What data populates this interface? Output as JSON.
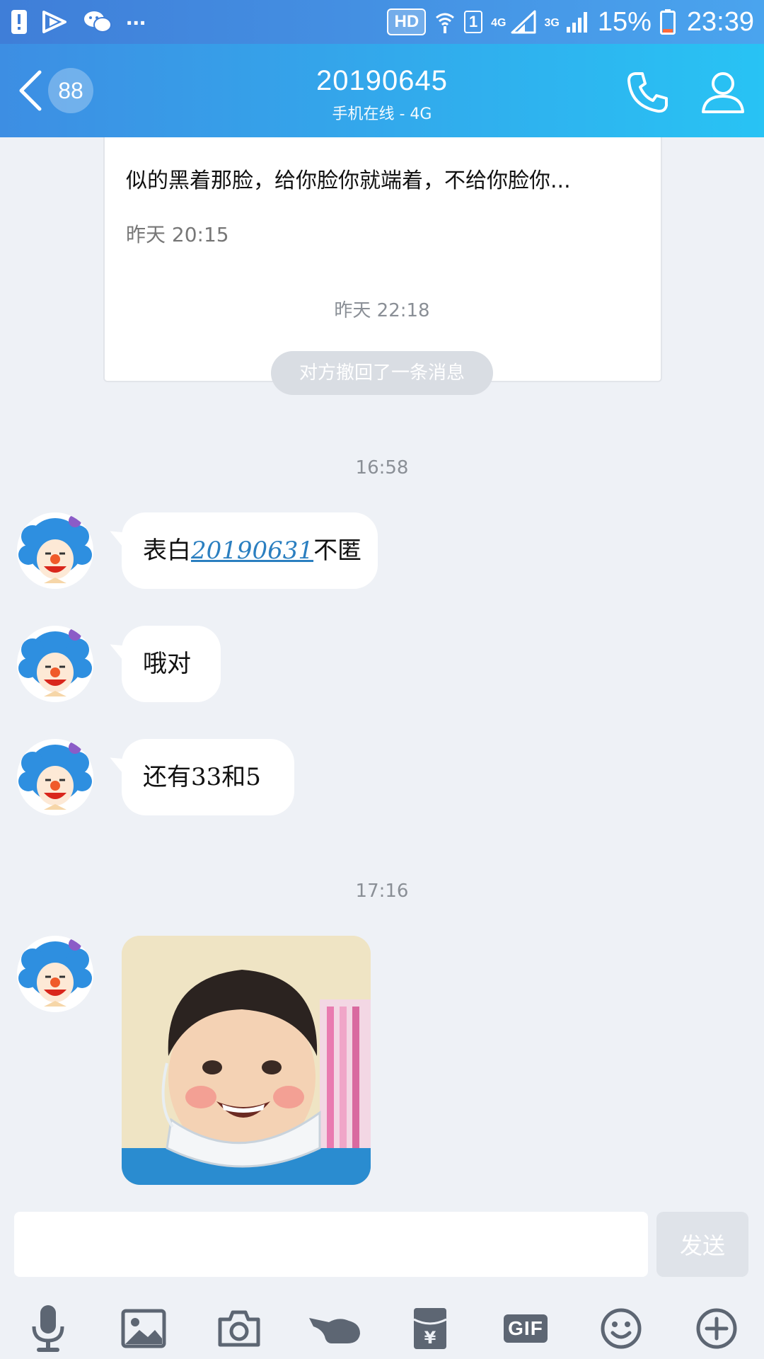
{
  "status_bar": {
    "hd": "HD",
    "sim": "1",
    "net1": "4G",
    "net2": "3G",
    "battery": "15%",
    "time": "23:39",
    "more": "..."
  },
  "header": {
    "unread_count": "88",
    "title": "20190645",
    "subtitle": "手机在线 - 4G"
  },
  "messages": {
    "card": {
      "body": "似的黑着那脸，给你脸你就端着，不给你脸你...",
      "time": "昨天 20:15"
    },
    "sep1": "昨天 22:18",
    "recall": "对方撤回了一条消息",
    "sep2": "16:58",
    "m1_prefix": "表白",
    "m1_link": "20190631",
    "m1_suffix": "不匿",
    "m2": "哦对",
    "m3": "还有33和5",
    "sep3": "17:16"
  },
  "input": {
    "placeholder": "",
    "send_label": "发送"
  },
  "toolbar": {
    "gif": "GIF"
  },
  "icons": [
    "mic-icon",
    "image-icon",
    "camera-icon",
    "poke-icon",
    "red-packet-icon",
    "gif-icon",
    "emoji-icon",
    "plus-icon"
  ],
  "colors": {
    "header_start": "#3d8ee3",
    "header_end": "#28c3f4",
    "background": "#eef1f6",
    "link": "#2b7fc0",
    "icon_gray": "#5d6673"
  }
}
